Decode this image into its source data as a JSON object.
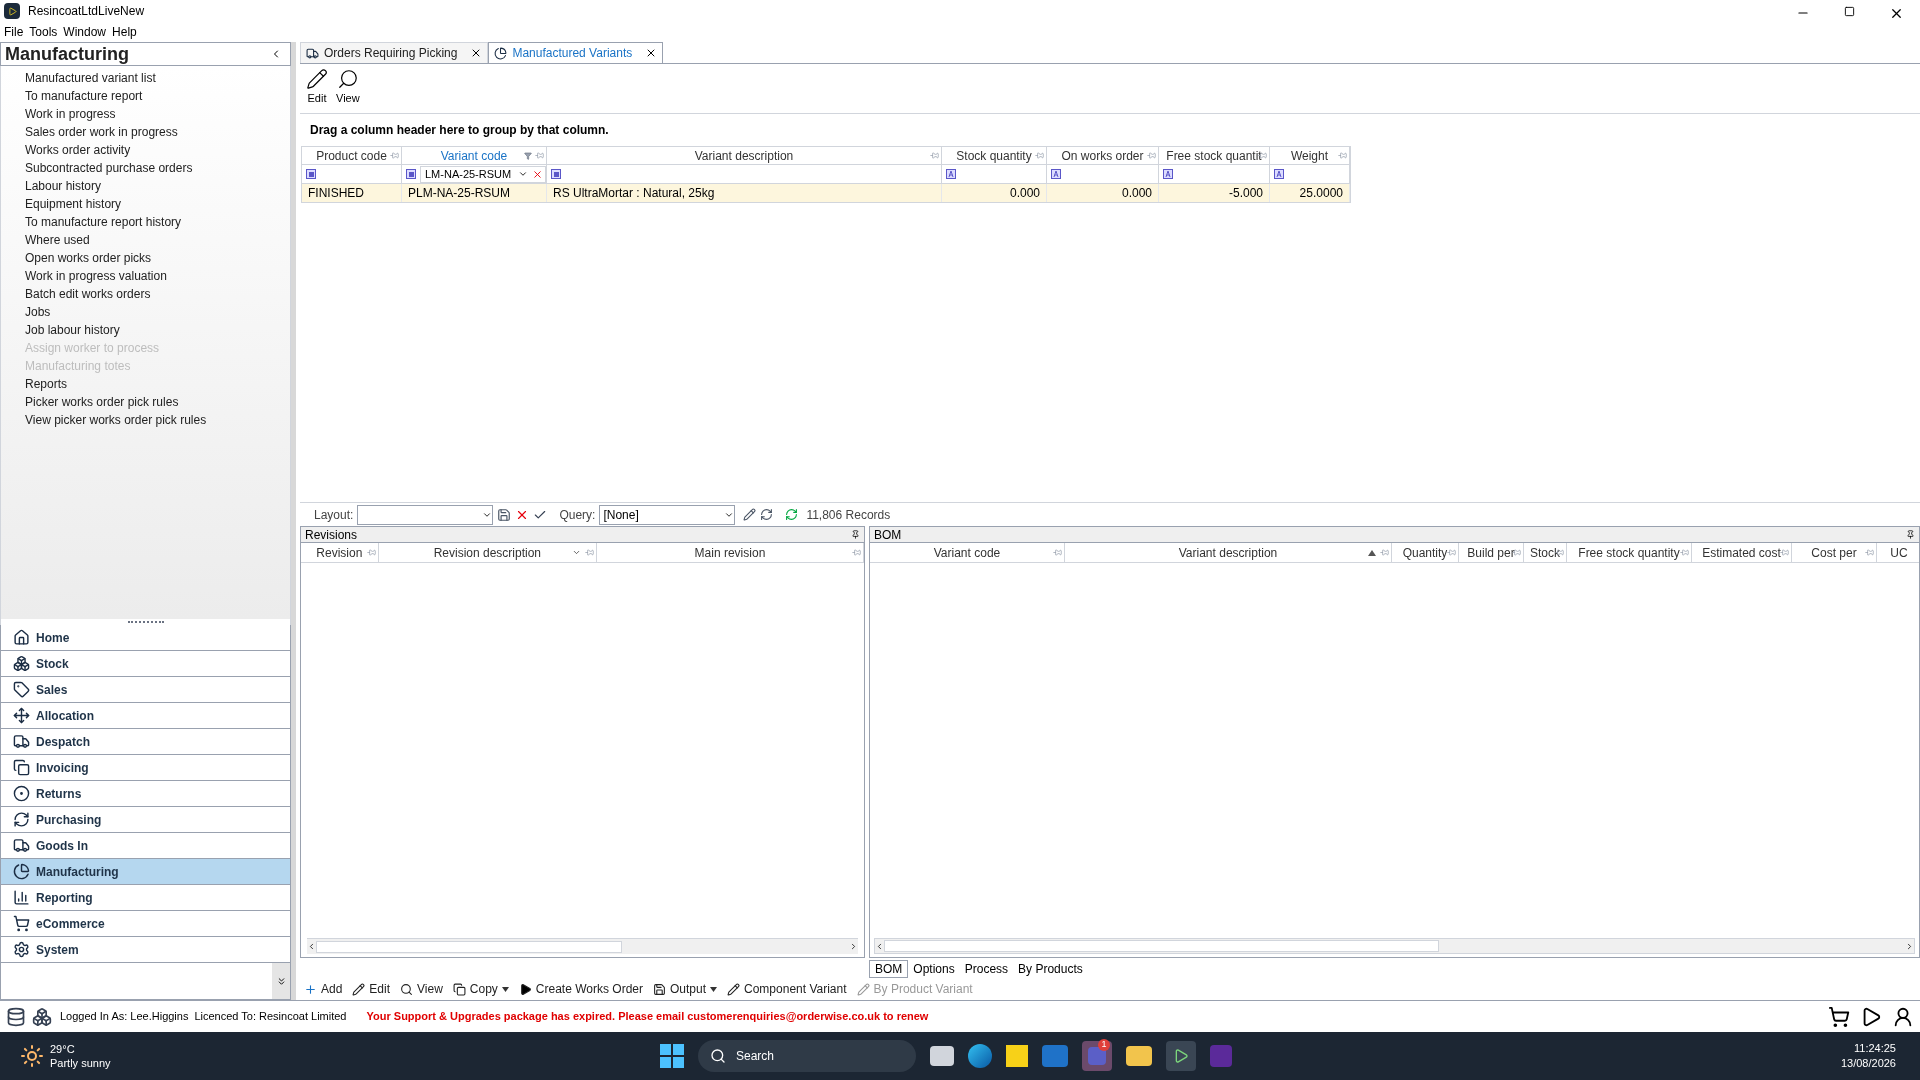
{
  "window": {
    "title": "ResincoatLtdLiveNew"
  },
  "menu": [
    "File",
    "Tools",
    "Window",
    "Help"
  ],
  "sidebar": {
    "title": "Manufacturing",
    "items": [
      {
        "label": "Manufactured variant list",
        "disabled": false
      },
      {
        "label": "To manufacture report",
        "disabled": false
      },
      {
        "label": "Work in progress",
        "disabled": false
      },
      {
        "label": "Sales order work in progress",
        "disabled": false
      },
      {
        "label": "Works order activity",
        "disabled": false
      },
      {
        "label": "Subcontracted purchase orders",
        "disabled": false
      },
      {
        "label": "Labour history",
        "disabled": false
      },
      {
        "label": "Equipment history",
        "disabled": false
      },
      {
        "label": "To manufacture report history",
        "disabled": false
      },
      {
        "label": "Where used",
        "disabled": false
      },
      {
        "label": "Open works order picks",
        "disabled": false
      },
      {
        "label": "Work in progress valuation",
        "disabled": false
      },
      {
        "label": "Batch edit works orders",
        "disabled": false
      },
      {
        "label": "Jobs",
        "disabled": false
      },
      {
        "label": "Job labour history",
        "disabled": false
      },
      {
        "label": "Assign worker to process",
        "disabled": true
      },
      {
        "label": "Manufacturing totes",
        "disabled": true
      },
      {
        "label": "Reports",
        "disabled": false
      },
      {
        "label": "Picker works order pick rules",
        "disabled": false
      },
      {
        "label": "View picker works order pick rules",
        "disabled": false
      }
    ],
    "nav": [
      {
        "label": "Home",
        "selected": false
      },
      {
        "label": "Stock",
        "selected": false
      },
      {
        "label": "Sales",
        "selected": false
      },
      {
        "label": "Allocation",
        "selected": false
      },
      {
        "label": "Despatch",
        "selected": false
      },
      {
        "label": "Invoicing",
        "selected": false
      },
      {
        "label": "Returns",
        "selected": false
      },
      {
        "label": "Purchasing",
        "selected": false
      },
      {
        "label": "Goods In",
        "selected": false
      },
      {
        "label": "Manufacturing",
        "selected": true
      },
      {
        "label": "Reporting",
        "selected": false
      },
      {
        "label": "eCommerce",
        "selected": false
      },
      {
        "label": "System",
        "selected": false
      }
    ]
  },
  "tabs": [
    {
      "label": "Orders Requiring Picking",
      "selected": false
    },
    {
      "label": "Manufactured Variants",
      "selected": true
    }
  ],
  "toolbar": [
    "Edit",
    "View"
  ],
  "group_hint": "Drag a column header here to group by that column.",
  "grid": {
    "columns": [
      {
        "label": "Product code",
        "filtered": false,
        "kind": "list"
      },
      {
        "label": "Variant code",
        "filtered": true,
        "kind": "list",
        "filter_value": "LM-NA-25-RSUM"
      },
      {
        "label": "Variant description",
        "filtered": false,
        "kind": "list"
      },
      {
        "label": "Stock quantity",
        "filtered": false,
        "kind": "text"
      },
      {
        "label": "On works order",
        "filtered": false,
        "kind": "text"
      },
      {
        "label": "Free stock quantit",
        "filtered": false,
        "kind": "text"
      },
      {
        "label": "Weight",
        "filtered": false,
        "kind": "text"
      }
    ],
    "rows": [
      {
        "selected": true,
        "cells": [
          "FINISHED",
          "PLM-NA-25-RSUM",
          "RS UltraMortar : Natural, 25kg",
          "0.000",
          "0.000",
          "-5.000",
          "25.0000"
        ]
      }
    ]
  },
  "layout_bar": {
    "layout_label": "Layout:",
    "query_label": "Query:",
    "query_value": "[None]",
    "records": "11,806 Records"
  },
  "revisions": {
    "title": "Revisions",
    "columns": [
      "Revision",
      "Revision description",
      "Main revision"
    ]
  },
  "bom": {
    "title": "BOM",
    "columns": [
      "Variant code",
      "Variant description",
      "Quantity",
      "Build per",
      "Stock",
      "Free stock quantity",
      "Estimated cost",
      "Cost per",
      "UC"
    ],
    "tabs": [
      {
        "label": "BOM",
        "selected": true
      },
      {
        "label": "Options",
        "selected": false
      },
      {
        "label": "Process",
        "selected": false
      },
      {
        "label": "By Products",
        "selected": false
      }
    ]
  },
  "actions": [
    {
      "label": "Add",
      "disabled": false,
      "dropdown": false
    },
    {
      "label": "Edit",
      "disabled": false,
      "dropdown": false
    },
    {
      "label": "View",
      "disabled": false,
      "dropdown": false
    },
    {
      "label": "Copy",
      "disabled": false,
      "dropdown": true
    },
    {
      "label": "Create Works Order",
      "disabled": false,
      "dropdown": false
    },
    {
      "label": "Output",
      "disabled": false,
      "dropdown": true
    },
    {
      "label": "Component Variant",
      "disabled": false,
      "dropdown": false
    },
    {
      "label": "By Product Variant",
      "disabled": true,
      "dropdown": false
    }
  ],
  "status_bar": {
    "user": "Logged In As: Lee.Higgins",
    "licence": "Licenced To: Resincoat Limited",
    "warning": "Your Support & Upgrades package has expired. Please email customerenquiries@orderwise.co.uk to renew"
  },
  "taskbar": {
    "temperature": "29°C",
    "weather": "Partly sunny",
    "search": "Search",
    "badge": "1",
    "time": "11:24:25",
    "date": "13/08/2026"
  }
}
